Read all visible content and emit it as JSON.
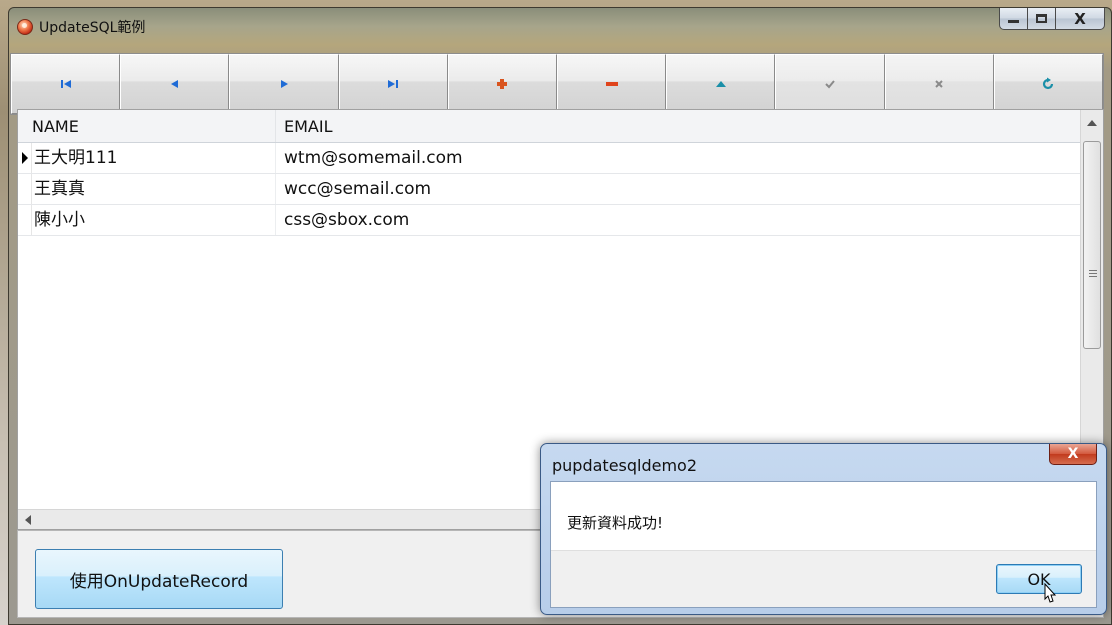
{
  "window": {
    "title": "UpdateSQL範例",
    "controls": {
      "minimize": "minimize",
      "maximize": "maximize",
      "close": "X"
    }
  },
  "navigator": {
    "buttons": [
      {
        "name": "first-record-button",
        "icon": "first-icon",
        "enabled": true
      },
      {
        "name": "prior-record-button",
        "icon": "prior-icon",
        "enabled": true
      },
      {
        "name": "next-record-button",
        "icon": "next-icon",
        "enabled": true
      },
      {
        "name": "last-record-button",
        "icon": "last-icon",
        "enabled": true
      },
      {
        "name": "insert-record-button",
        "icon": "plus-icon",
        "enabled": true
      },
      {
        "name": "delete-record-button",
        "icon": "minus-icon",
        "enabled": true
      },
      {
        "name": "edit-record-button",
        "icon": "edit-icon",
        "enabled": true
      },
      {
        "name": "post-record-button",
        "icon": "check-icon",
        "enabled": false
      },
      {
        "name": "cancel-record-button",
        "icon": "cancel-icon",
        "enabled": false
      },
      {
        "name": "refresh-button",
        "icon": "refresh-icon",
        "enabled": true
      }
    ],
    "colors": {
      "nav_arrows": "#1f6bd6",
      "plus": "#d9541e",
      "minus": "#e0441c",
      "edit": "#1a8fa8",
      "disabled": "#8a8a8a"
    }
  },
  "grid": {
    "columns": [
      "NAME",
      "EMAIL"
    ],
    "rows": [
      {
        "name": "王大明111",
        "email": "wtm@somemail.com",
        "current": true
      },
      {
        "name": "王真真",
        "email": "wcc@semail.com",
        "current": false
      },
      {
        "name": "陳小小",
        "email": "css@sbox.com",
        "current": false
      }
    ]
  },
  "bottom": {
    "action_button": "使用OnUpdateRecord"
  },
  "dialog": {
    "title": "pupdatesqldemo2",
    "close": "X",
    "message": "更新資料成功!",
    "ok": "OK"
  }
}
